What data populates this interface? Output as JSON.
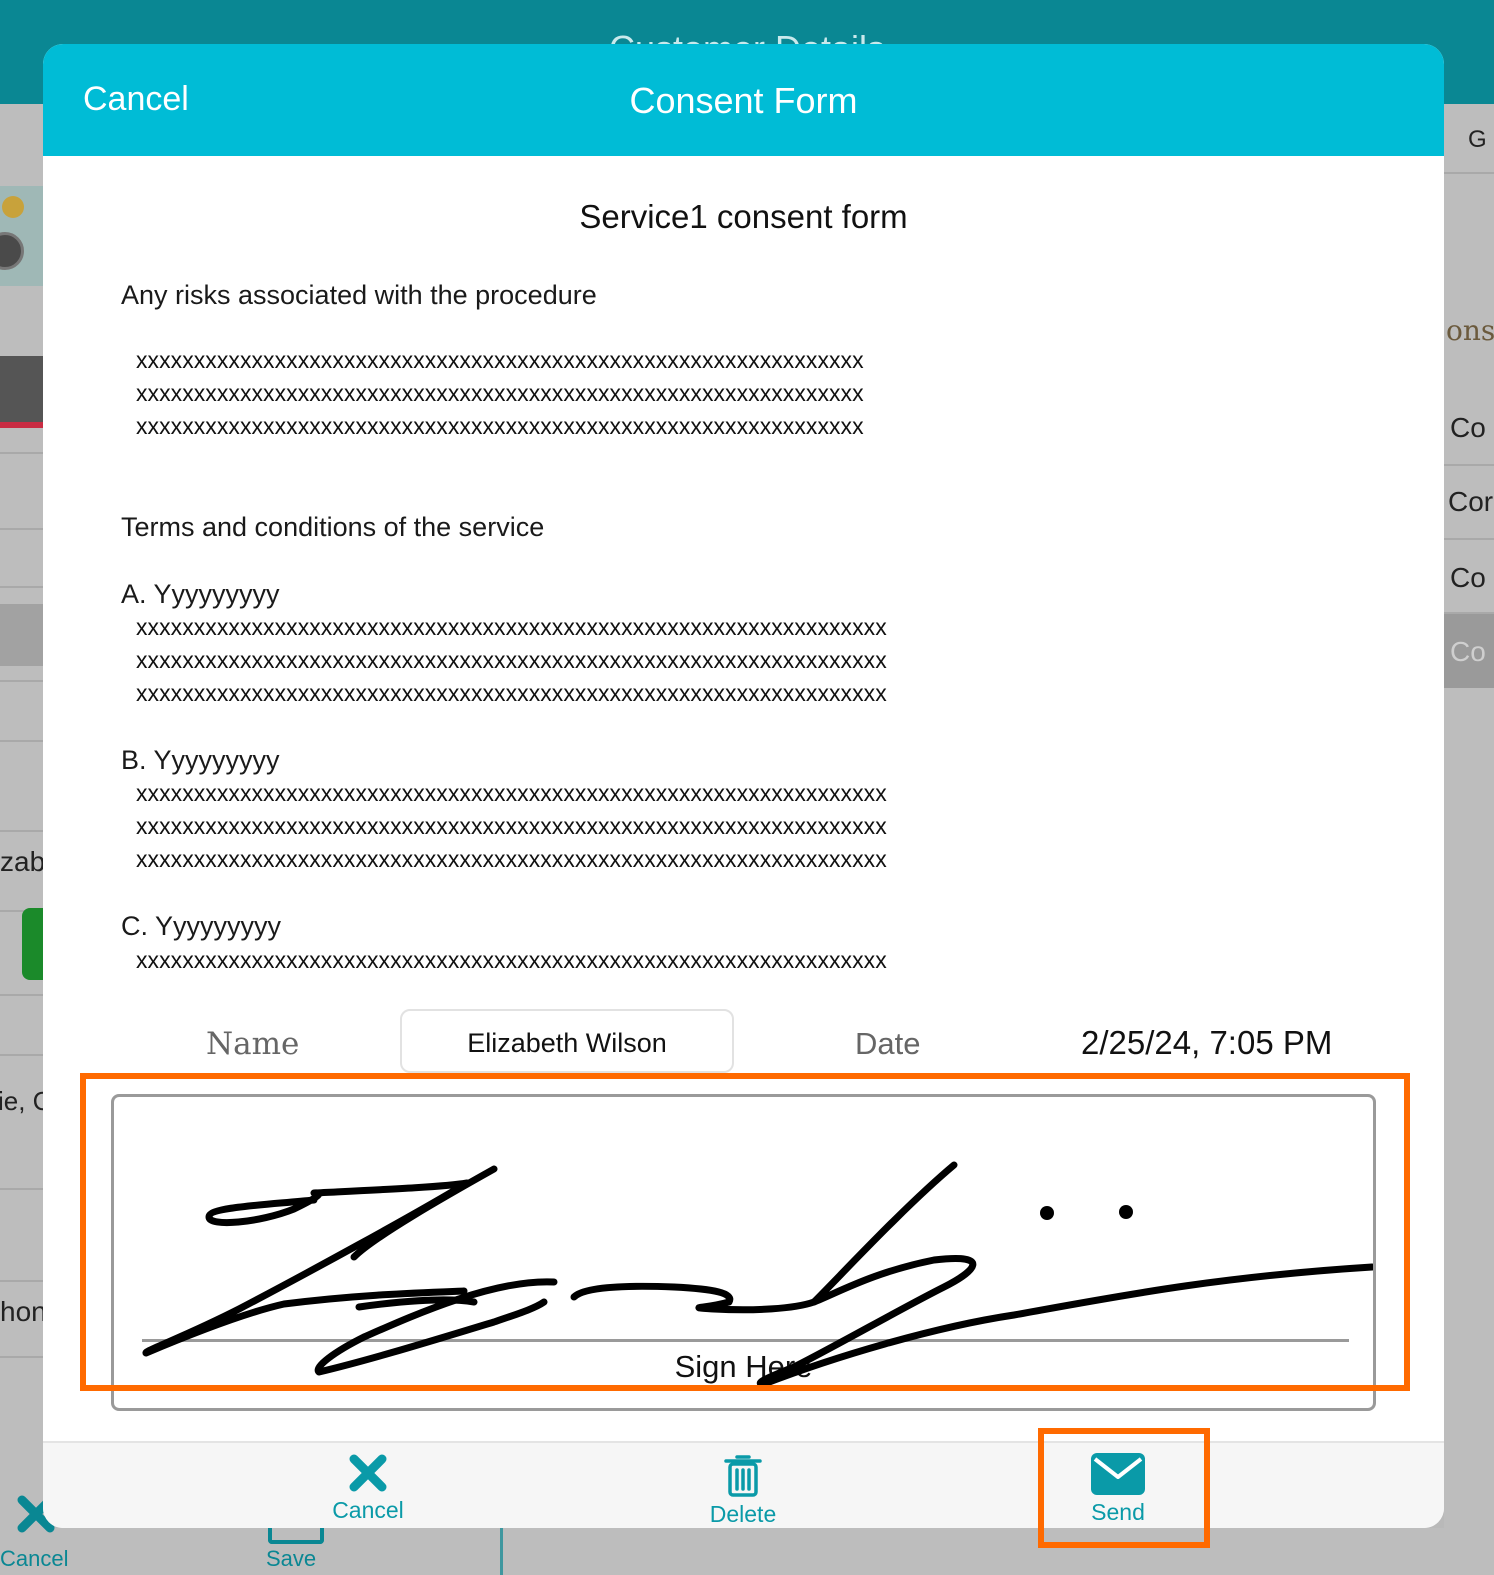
{
  "background": {
    "top_title": "Customer Details",
    "left_snippets": [
      "zab",
      "ie, C",
      "hon"
    ],
    "right_snippets": [
      "G",
      "ons",
      "Co",
      "Cor",
      "Co",
      "Co"
    ],
    "tabs": {
      "cancel_label": "Cancel",
      "save_label": "Save"
    }
  },
  "modal": {
    "cancel_label": "Cancel",
    "title": "Consent Form"
  },
  "form": {
    "title": "Service1 consent form",
    "risks_heading": "Any risks associated with the procedure",
    "risks_lines": [
      "xxxxxxxxxxxxxxxxxxxxxxxxxxxxxxxxxxxxxxxxxxxxxxxxxxxxxxxxxxxxxxx",
      "xxxxxxxxxxxxxxxxxxxxxxxxxxxxxxxxxxxxxxxxxxxxxxxxxxxxxxxxxxxxxxx",
      "xxxxxxxxxxxxxxxxxxxxxxxxxxxxxxxxxxxxxxxxxxxxxxxxxxxxxxxxxxxxxxx"
    ],
    "terms_heading": "Terms and conditions of the service",
    "items": [
      {
        "label": "A. Yyyyyyyyy",
        "lines": [
          "xxxxxxxxxxxxxxxxxxxxxxxxxxxxxxxxxxxxxxxxxxxxxxxxxxxxxxxxxxxxxxxxx",
          "xxxxxxxxxxxxxxxxxxxxxxxxxxxxxxxxxxxxxxxxxxxxxxxxxxxxxxxxxxxxxxxxx",
          "xxxxxxxxxxxxxxxxxxxxxxxxxxxxxxxxxxxxxxxxxxxxxxxxxxxxxxxxxxxxxxxxx"
        ]
      },
      {
        "label": "B. Yyyyyyyyy",
        "lines": [
          "xxxxxxxxxxxxxxxxxxxxxxxxxxxxxxxxxxxxxxxxxxxxxxxxxxxxxxxxxxxxxxxxx",
          "xxxxxxxxxxxxxxxxxxxxxxxxxxxxxxxxxxxxxxxxxxxxxxxxxxxxxxxxxxxxxxxxx",
          "xxxxxxxxxxxxxxxxxxxxxxxxxxxxxxxxxxxxxxxxxxxxxxxxxxxxxxxxxxxxxxxxx"
        ]
      },
      {
        "label": "C. Yyyyyyyyy",
        "lines": [
          "xxxxxxxxxxxxxxxxxxxxxxxxxxxxxxxxxxxxxxxxxxxxxxxxxxxxxxxxxxxxxxxxx"
        ]
      }
    ],
    "name_label": "Name",
    "name_value": "Elizabeth Wilson",
    "date_label": "Date",
    "date_value": "2/25/24, 7:05 PM",
    "sign_label": "Sign Here"
  },
  "toolbar": {
    "cancel_label": "Cancel",
    "delete_label": "Delete",
    "send_label": "Send"
  },
  "colors": {
    "header": "#00bcd6",
    "accent": "#0a9aa8",
    "highlight": "#ff6a00",
    "app_bar": "#0a8793"
  },
  "icons": {
    "toolbar_cancel": "close-x-icon",
    "toolbar_delete": "trash-icon",
    "toolbar_send": "envelope-icon"
  }
}
